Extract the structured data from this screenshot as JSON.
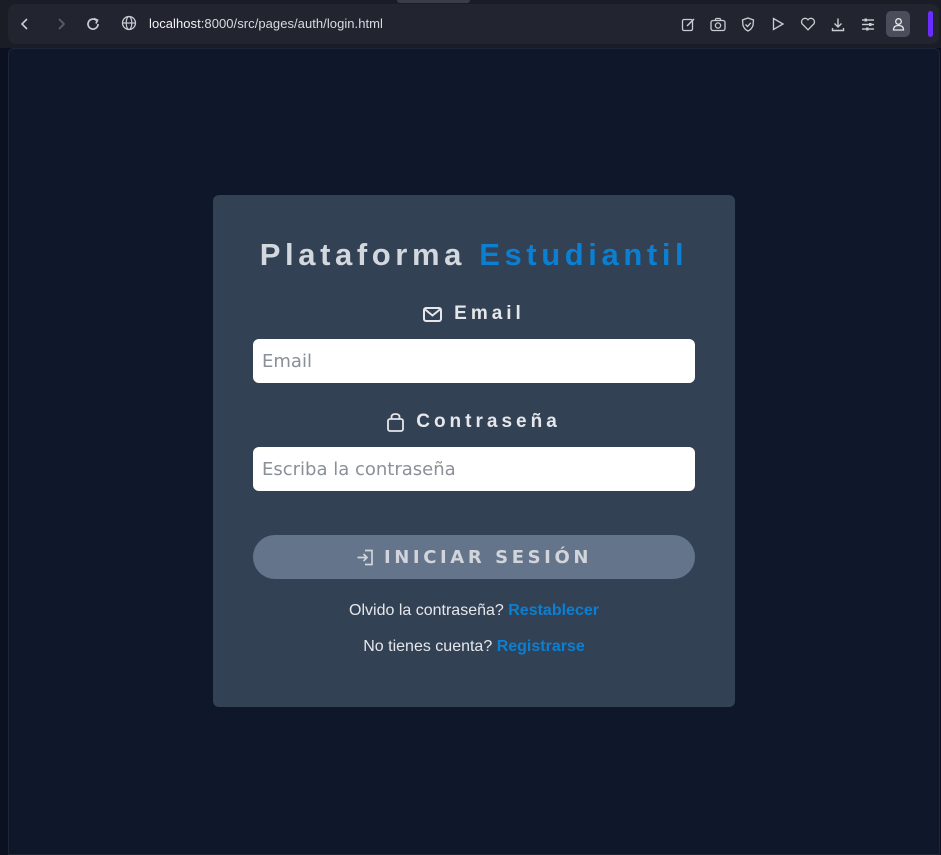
{
  "browser": {
    "url_host": "localhost",
    "url_rest": ":8000/src/pages/auth/login.html"
  },
  "card": {
    "title_main": "Plataforma",
    "title_accent": "Estudiantil",
    "email_label": "Email",
    "email_placeholder": "Email",
    "password_label": "Contraseña",
    "password_placeholder": "Escriba la contraseña",
    "submit_label": "INICIAR SESIÓN",
    "forgot_text": "Olvido la contraseña?",
    "forgot_link": "Restablecer",
    "register_text": "No tienes cuenta?",
    "register_link": "Registrarse"
  },
  "colors": {
    "page_bg": "#0f172a",
    "card_bg": "#334155",
    "accent": "#0b7fd1",
    "button_bg": "#64748b"
  },
  "icons": [
    "back-arrow-icon",
    "forward-arrow-icon",
    "reload-icon",
    "globe-icon",
    "edit-icon",
    "camera-icon",
    "shield-icon",
    "play-icon",
    "heart-icon",
    "download-icon",
    "menu-list-icon",
    "profile-icon",
    "envelope-icon",
    "lock-icon",
    "sign-in-icon"
  ]
}
